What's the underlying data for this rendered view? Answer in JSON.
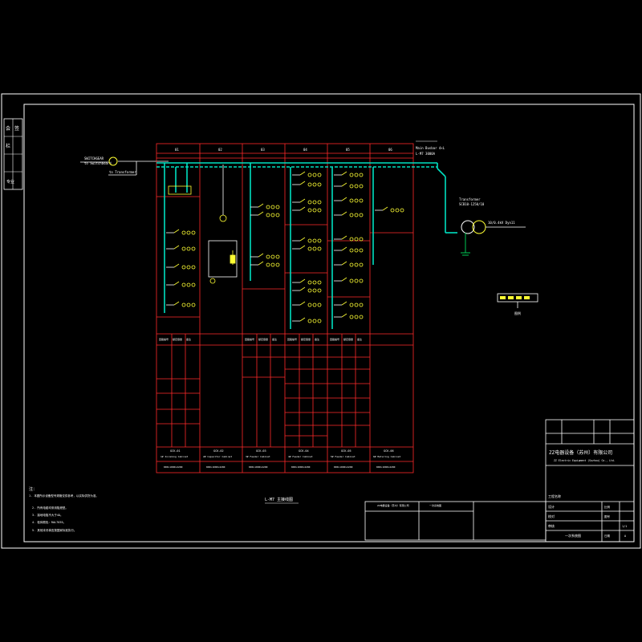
{
  "colors": {
    "background": "#000000",
    "frame": "#ffffff",
    "panel": "#ff2a2a",
    "bus": "#00e0c0",
    "devices": "#ffff33",
    "text": "#ffffff",
    "wiring": "#00c853"
  },
  "drawing": {
    "title": "L-M7 主接线图",
    "company_cn": "ZZ电器设备（苏州）有限公司",
    "company_en": "ZZ Electric Equipment (Suzhou) Co., Ltd."
  },
  "incomer": {
    "label_top": "SWITCHGEAR",
    "label_sub": "to Switchboard",
    "feeder_note": "to Transformer"
  },
  "bus": {
    "label1": "Main Busbar 4×L",
    "label2": "L-M7 3000A"
  },
  "panels": {
    "header_numbers": [
      "01",
      "02",
      "03",
      "04",
      "05",
      "06"
    ],
    "names": [
      "1# Incoming Cabinet",
      "2# Capacitor Cabinet",
      "3# Feeder Cabinet",
      "4# Feeder Cabinet",
      "5# Feeder Cabinet",
      "6# Metering Cabinet"
    ],
    "codes": [
      "GCK-01",
      "GCK-02",
      "GCK-03",
      "GCK-04",
      "GCK-05",
      "GCK-06"
    ],
    "footer_codes": [
      "800×1000×2200",
      "800×1000×2200",
      "800×1000×2200",
      "800×1000×2200",
      "800×1000×2200",
      "800×1000×2200"
    ]
  },
  "table_headers": [
    "回路编号",
    "额定容量",
    "备注"
  ],
  "transformer": {
    "label": "Transformer",
    "rating": "SCB10-1250/10",
    "ratio": "10/0.4kV Dyn11"
  },
  "legend_box_label": "图例",
  "notes": {
    "heading": "注：",
    "lines": [
      "1. 本图所示设备型号规格仅供参考，以实际供货为准。",
      "2. 所有电缆均采用阻燃型。",
      "3. 接地电阻不大于4Ω。",
      "4. 柜体颜色：RAL7035。",
      "5. 其他未尽事宜按国家标准执行。"
    ]
  },
  "title_block": {
    "project_label": "工程名称",
    "drawing_no_label": "图号",
    "scale_label": "比例",
    "date_label": "日期",
    "sheet": "1/1",
    "rev": "A",
    "designer_label": "设计",
    "checker_label": "校对",
    "approver_label": "审核",
    "drawing_name": "一次系统图"
  },
  "side_strip": [
    "会",
    "签",
    "栏",
    "专业"
  ]
}
